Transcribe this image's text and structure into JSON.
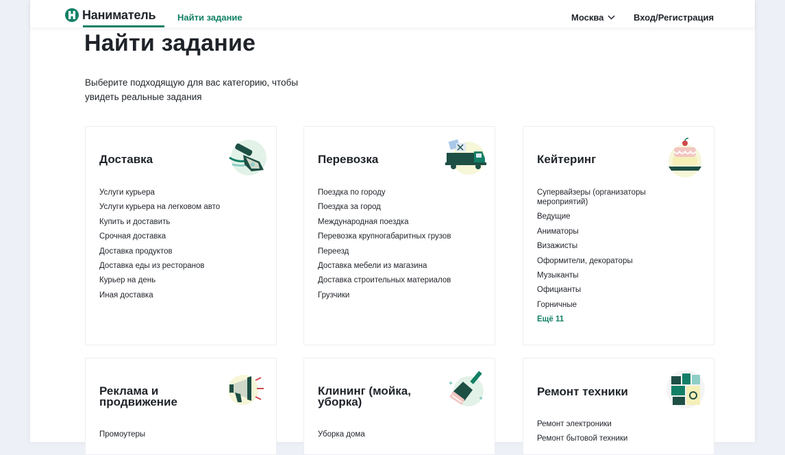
{
  "header": {
    "logo_text": "Наниматель",
    "nav_find": "Найти задание",
    "city": "Москва",
    "login": "Вход/Регистрация"
  },
  "page": {
    "title": "Найти задание",
    "subtitle": "Выберите подходящую для вас категорию, чтобы увидеть реальные задания"
  },
  "colors": {
    "brand": "#128066",
    "text": "#1f2329",
    "border": "#eceef2"
  },
  "categories": [
    {
      "title": "Доставка",
      "icon": "delivery-hand-icon",
      "items": [
        "Услуги курьера",
        "Услуги курьера на легковом авто",
        "Купить и доставить",
        "Срочная доставка",
        "Доставка продуктов",
        "Доставка еды из ресторанов",
        "Курьер на день",
        "Иная доставка"
      ]
    },
    {
      "title": "Перевозка",
      "icon": "truck-icon",
      "items": [
        "Поездка по городу",
        "Поездка за город",
        "Международная поездка",
        "Перевозка крупногабаритных грузов",
        "Переезд",
        "Доставка мебели из магазина",
        "Доставка строительных материалов",
        "Грузчики"
      ]
    },
    {
      "title": "Кейтеринг",
      "icon": "cake-icon",
      "items": [
        "Супервайзеры (организаторы мероприятий)",
        "Ведущие",
        "Аниматоры",
        "Визажисты",
        "Оформители, декораторы",
        "Музыканты",
        "Официанты",
        "Горничные"
      ],
      "more": "Ещё 11"
    },
    {
      "title": "Реклама и продвижение",
      "icon": "megaphone-icon",
      "items": [
        "Промоутеры"
      ]
    },
    {
      "title": "Клининг (мойка, уборка)",
      "icon": "brush-icon",
      "items": [
        "Уборка дома"
      ]
    },
    {
      "title": "Ремонт техники",
      "icon": "appliance-icon",
      "items": [
        "Ремонт электроники",
        "Ремонт бытовой техники"
      ]
    }
  ]
}
